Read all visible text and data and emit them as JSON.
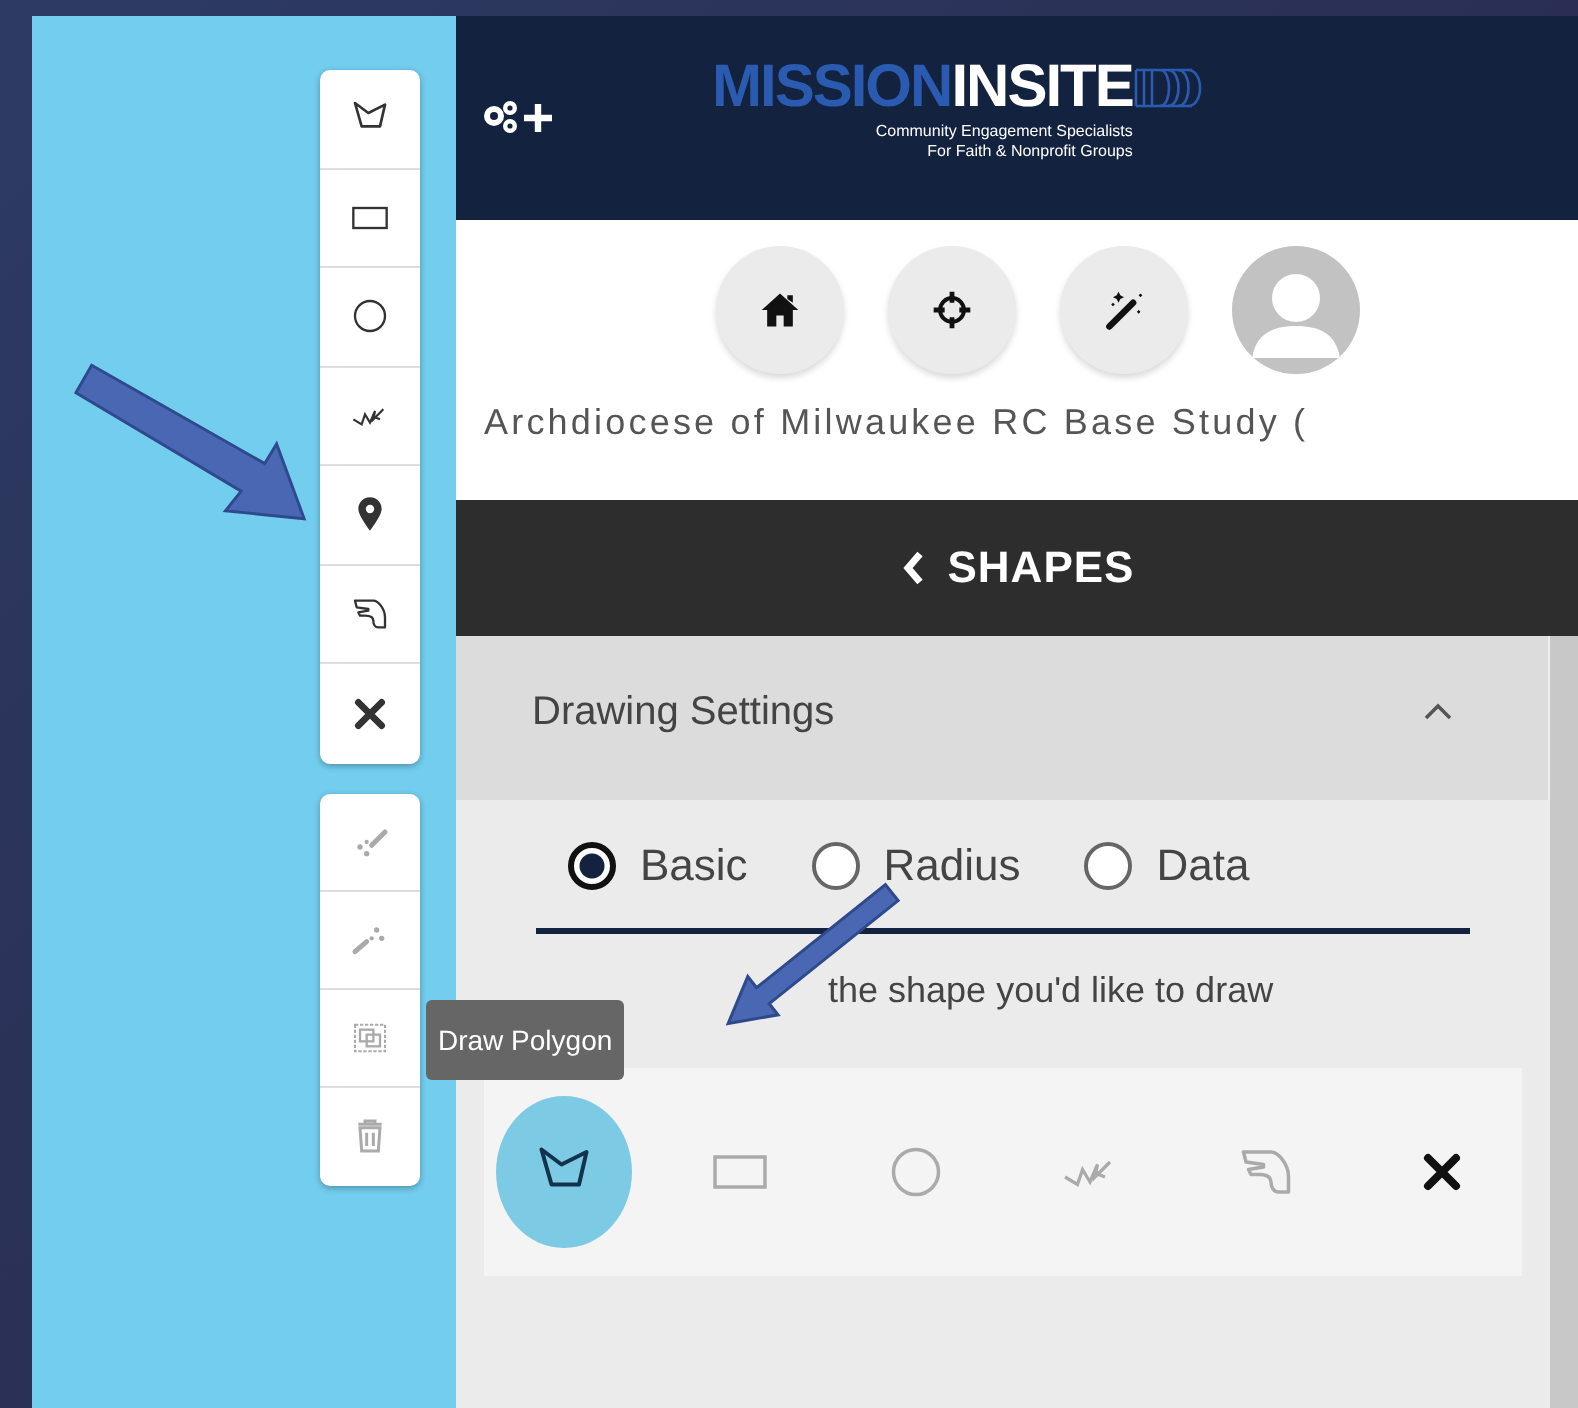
{
  "map_toolbar": {
    "groups": [
      {
        "tools": [
          {
            "kind": "polygon",
            "disabled": false
          },
          {
            "kind": "rectangle",
            "disabled": false
          },
          {
            "kind": "circle",
            "disabled": false
          },
          {
            "kind": "line",
            "disabled": false
          },
          {
            "kind": "marker",
            "disabled": false
          },
          {
            "kind": "freehand",
            "disabled": false
          },
          {
            "kind": "cancel",
            "disabled": false
          }
        ]
      },
      {
        "tools": [
          {
            "kind": "cut",
            "disabled": true
          },
          {
            "kind": "merge",
            "disabled": true
          },
          {
            "kind": "select",
            "disabled": true
          },
          {
            "kind": "delete",
            "disabled": true
          }
        ]
      }
    ]
  },
  "tooltip": "Draw Polygon",
  "header": {
    "logo": {
      "first": "MISSION",
      "second": "INSITE",
      "tagline": [
        "Community Engagement Specialists",
        "For Faith & Nonprofit Groups"
      ]
    }
  },
  "nav_buttons": [
    {
      "kind": "home"
    },
    {
      "kind": "locate"
    },
    {
      "kind": "wand"
    },
    {
      "kind": "avatar"
    }
  ],
  "study_title": "Archdiocese of Milwaukee RC Base Study (",
  "section_bar": {
    "title": "SHAPES"
  },
  "drawing_settings": {
    "title": "Drawing Settings",
    "expanded": true,
    "modes": [
      {
        "label": "Basic",
        "selected": true
      },
      {
        "label": "Radius",
        "selected": false
      },
      {
        "label": "Data",
        "selected": false
      }
    ],
    "hint": "the shape you'd like to draw",
    "shapes": [
      {
        "kind": "polygon",
        "selected": true
      },
      {
        "kind": "rectangle",
        "selected": false
      },
      {
        "kind": "circle",
        "selected": false
      },
      {
        "kind": "line",
        "selected": false
      },
      {
        "kind": "freehand",
        "selected": false
      },
      {
        "kind": "cancel",
        "selected": false
      }
    ]
  }
}
